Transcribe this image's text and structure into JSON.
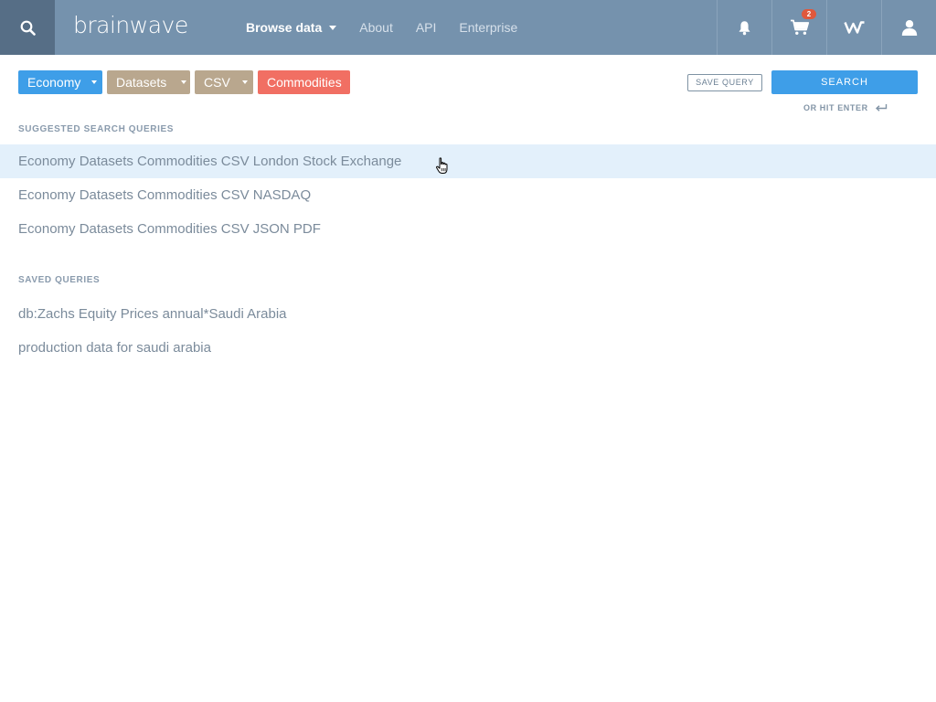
{
  "header": {
    "logo_text": "brainwave",
    "nav": [
      {
        "label": "Browse data",
        "active": true,
        "has_caret": true
      },
      {
        "label": "About"
      },
      {
        "label": "API"
      },
      {
        "label": "Enterprise"
      }
    ],
    "icons": [
      "search-icon",
      "bell-icon",
      "cart-icon",
      "brand-mark-icon",
      "user-icon"
    ],
    "cart_count": "2",
    "colors": {
      "bar": "#7592ad",
      "search_bg": "#566e86",
      "badge": "#e0583c"
    }
  },
  "filters": [
    {
      "label": "Economy",
      "color": "#3e9ee8",
      "dropdown": true
    },
    {
      "label": "Datasets",
      "color": "#b9a78e",
      "dropdown": true
    },
    {
      "label": "CSV",
      "color": "#b9a78e",
      "dropdown": true
    },
    {
      "label": "Commodities",
      "color": "#f16f63",
      "dropdown": false
    }
  ],
  "actions": {
    "save_query": "SAVE QUERY",
    "search": "SEARCH",
    "hit_enter": "OR HIT ENTER"
  },
  "suggested": {
    "title": "SUGGESTED SEARCH QUERIES",
    "items": [
      "Economy Datasets Commodities CSV London Stock Exchange",
      "Economy Datasets Commodities CSV NASDAQ",
      "Economy Datasets Commodities CSV JSON PDF"
    ]
  },
  "saved": {
    "title": "SAVED QUERIES",
    "items": [
      "db:Zachs Equity Prices annual*Saudi Arabia",
      "production data for saudi arabia"
    ]
  }
}
